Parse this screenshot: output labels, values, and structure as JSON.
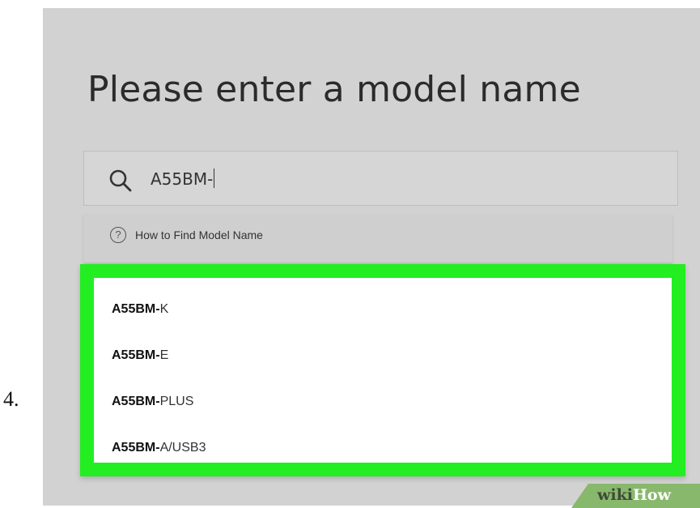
{
  "step_number": "4.",
  "page": {
    "title": "Please enter a model name"
  },
  "search": {
    "value": "A55BM-",
    "icon": "search-icon"
  },
  "help": {
    "icon": "question-circle-icon",
    "icon_glyph": "?",
    "label": "How to Find Model Name"
  },
  "suggestions": [
    {
      "prefix": "A55BM-",
      "suffix": "K"
    },
    {
      "prefix": "A55BM-",
      "suffix": "E"
    },
    {
      "prefix": "A55BM-",
      "suffix": "PLUS"
    },
    {
      "prefix": "A55BM-",
      "suffix": "A/USB3"
    }
  ],
  "watermark": {
    "wiki": "wiki",
    "how": "How"
  },
  "colors": {
    "panel_bg": "#d2d2d2",
    "highlight": "#22ee22",
    "watermark_bg": "#88b86c"
  }
}
